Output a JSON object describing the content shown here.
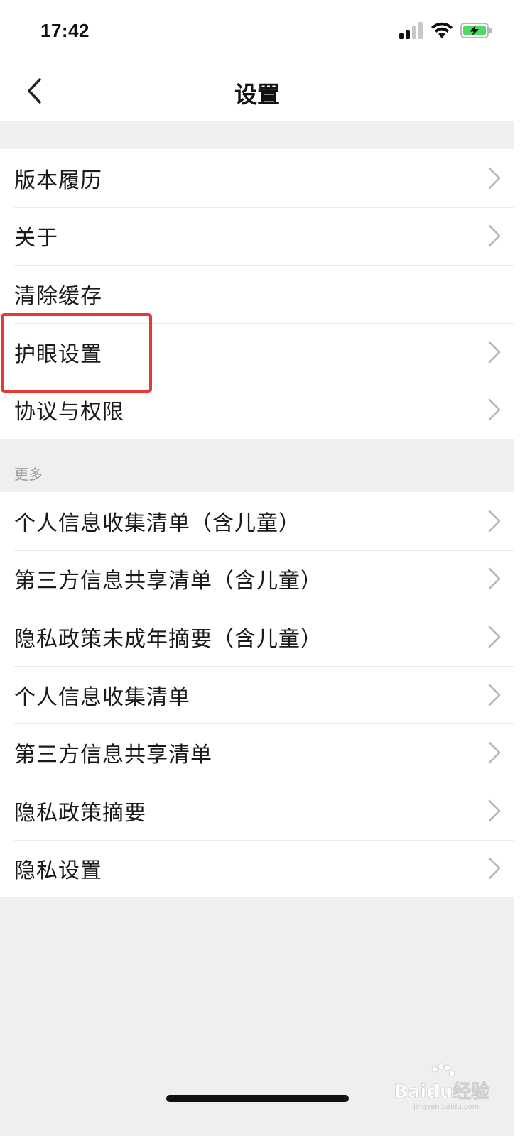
{
  "status_bar": {
    "time": "17:42"
  },
  "nav": {
    "title": "设置"
  },
  "group1": {
    "items": [
      {
        "label": "版本履历",
        "chevron": true
      },
      {
        "label": "关于",
        "chevron": true
      },
      {
        "label": "清除缓存",
        "chevron": false
      },
      {
        "label": "护眼设置",
        "chevron": true
      },
      {
        "label": "协议与权限",
        "chevron": true
      }
    ]
  },
  "section2": {
    "header": "更多"
  },
  "group2": {
    "items": [
      {
        "label": "个人信息收集清单（含儿童）",
        "chevron": true
      },
      {
        "label": "第三方信息共享清单（含儿童）",
        "chevron": true
      },
      {
        "label": "隐私政策未成年摘要（含儿童）",
        "chevron": true
      },
      {
        "label": "个人信息收集清单",
        "chevron": true
      },
      {
        "label": "第三方信息共享清单",
        "chevron": true
      },
      {
        "label": "隐私政策摘要",
        "chevron": true
      },
      {
        "label": "隐私设置",
        "chevron": true
      }
    ]
  },
  "watermark": {
    "text": "Baidu经验",
    "subtext": "jingyan.baidu.com"
  },
  "colors": {
    "highlight": "#e53935",
    "battery_fill": "#4cd964",
    "background": "#efeef0"
  },
  "icons": [
    "cellular-signal-icon",
    "wifi-icon",
    "battery-charging-icon",
    "back-chevron-icon",
    "chevron-right-icon"
  ]
}
